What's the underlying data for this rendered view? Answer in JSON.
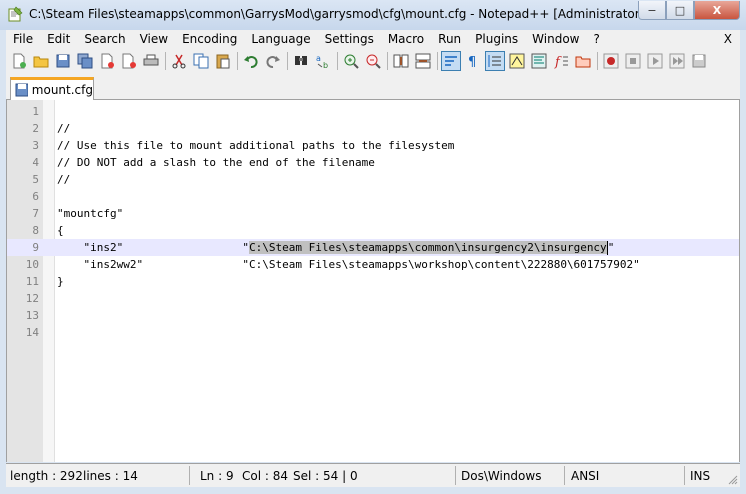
{
  "window": {
    "title": "C:\\Steam Files\\steamapps\\common\\GarrysMod\\garrysmod\\cfg\\mount.cfg - Notepad++ [Administrator]",
    "icon": "notepadpp-icon",
    "minimize": "−",
    "maximize": "□",
    "close": "X"
  },
  "menu": {
    "items": [
      "File",
      "Edit",
      "Search",
      "View",
      "Encoding",
      "Language",
      "Settings",
      "Macro",
      "Run",
      "Plugins",
      "Window",
      "?"
    ],
    "close_doc": "X"
  },
  "toolbar": {
    "icons": [
      "new-file-icon",
      "open-file-icon",
      "save-icon",
      "save-all-icon",
      "close-icon",
      "close-all-icon",
      "print-icon",
      "cut-icon",
      "copy-icon",
      "paste-icon",
      "undo-icon",
      "redo-icon",
      "find-icon",
      "replace-icon",
      "zoom-in-icon",
      "zoom-out-icon",
      "sync-vertical-icon",
      "sync-horizontal-icon",
      "word-wrap-icon",
      "show-all-chars-icon",
      "indent-guide-icon",
      "udl-icon",
      "doc-map-icon",
      "function-list-icon",
      "folder-workspace-icon",
      "record-macro-icon",
      "stop-record-icon",
      "play-macro-icon",
      "run-macro-multiple-icon",
      "save-macro-icon"
    ]
  },
  "tab": {
    "label": "mount.cfg"
  },
  "editor": {
    "lines": [
      {
        "num": "1",
        "text": ""
      },
      {
        "num": "2",
        "text": "//"
      },
      {
        "num": "3",
        "text": "// Use this file to mount additional paths to the filesystem"
      },
      {
        "num": "4",
        "text": "// DO NOT add a slash to the end of the filename"
      },
      {
        "num": "5",
        "text": "//"
      },
      {
        "num": "6",
        "text": ""
      },
      {
        "num": "7",
        "text": "\"mountcfg\""
      },
      {
        "num": "8",
        "text": "{"
      },
      {
        "num": "9",
        "text_before": "    \"ins2\"                  \"",
        "text_selected": "C:\\Steam Files\\steamapps\\common\\insurgency2\\insurgency",
        "text_after": "\""
      },
      {
        "num": "10",
        "text": "    \"ins2ww2\"               \"C:\\Steam Files\\steamapps\\workshop\\content\\222880\\601757902\""
      },
      {
        "num": "11",
        "text": "}"
      },
      {
        "num": "12",
        "text": ""
      },
      {
        "num": "13",
        "text": ""
      },
      {
        "num": "14",
        "text": ""
      }
    ]
  },
  "status": {
    "length": "length : 292",
    "lines": "lines : 14",
    "ln": "Ln : 9",
    "col": "Col : 84",
    "sel": "Sel : 54 | 0",
    "eol": "Dos\\Windows",
    "encoding": "ANSI",
    "mode": "INS"
  }
}
